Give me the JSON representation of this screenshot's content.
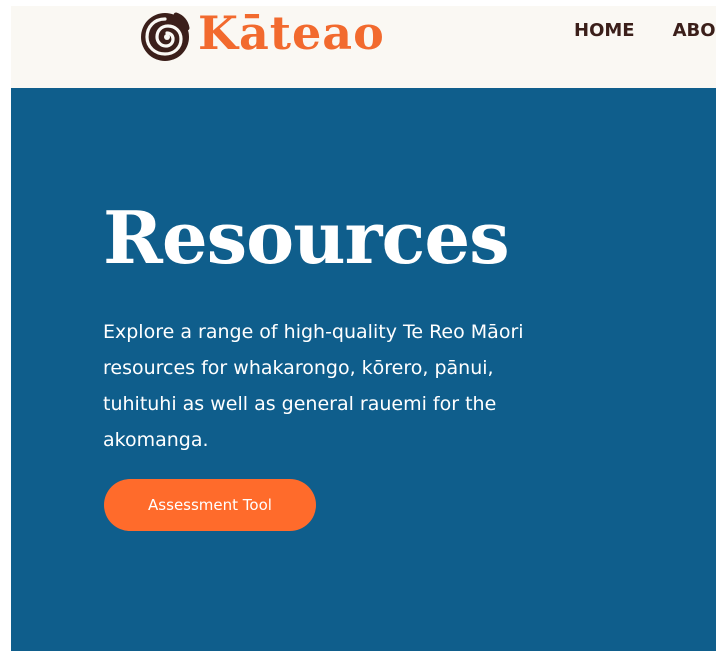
{
  "brand": {
    "name": "Kāteao",
    "logo_icon": "koru-spiral-icon",
    "name_color": "#f26a2e",
    "icon_color": "#3b1f1a"
  },
  "nav": {
    "items": [
      {
        "label": "HOME"
      },
      {
        "label": "ABOU"
      }
    ],
    "color": "#3b1f1a"
  },
  "hero": {
    "title": "Resources",
    "description": "Explore a range of high-quality Te Reo Māori resources for whakarongo, kōrero, pānui, tuhituhi as well as general rauemi for the akomanga.",
    "cta_label": "Assessment Tool",
    "background_color": "#0f5e8c",
    "cta_color": "#ff6b2b"
  },
  "header": {
    "background_color": "#faf8f3"
  }
}
